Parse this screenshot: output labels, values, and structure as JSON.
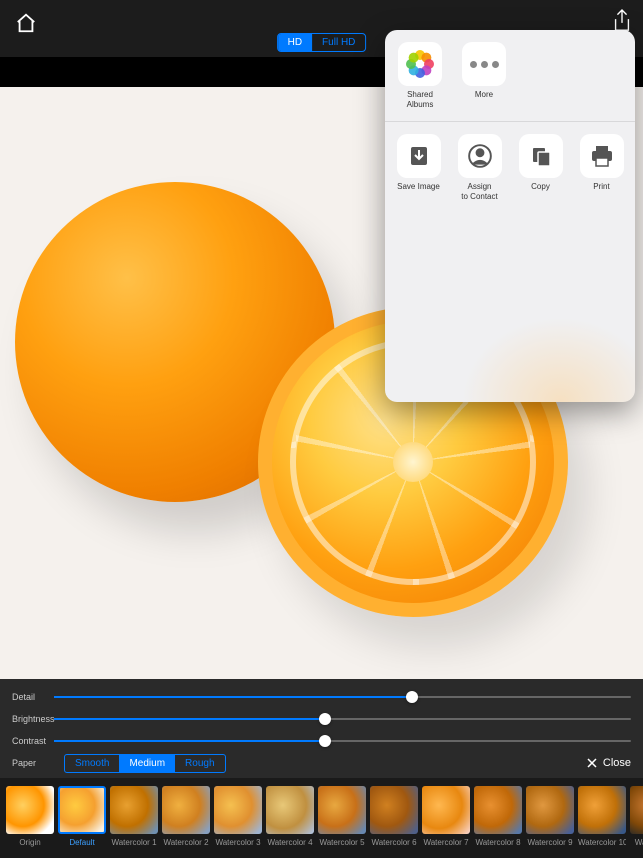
{
  "toolbar": {
    "quality": {
      "hd": "HD",
      "fullhd": "Full HD",
      "active": "hd"
    }
  },
  "sliders": {
    "detail": {
      "label": "Detail",
      "value": 62
    },
    "brightness": {
      "label": "Brightness",
      "value": 47
    },
    "contrast": {
      "label": "Contrast",
      "value": 47
    }
  },
  "paper": {
    "label": "Paper",
    "options": {
      "smooth": "Smooth",
      "medium": "Medium",
      "rough": "Rough"
    },
    "active": "medium"
  },
  "close_label": "Close",
  "filters": [
    {
      "id": "origin",
      "label": "Origin",
      "selected": false
    },
    {
      "id": "default",
      "label": "Default",
      "selected": true
    },
    {
      "id": "wc1",
      "label": "Watercolor 1",
      "selected": false
    },
    {
      "id": "wc2",
      "label": "Watercolor 2",
      "selected": false
    },
    {
      "id": "wc3",
      "label": "Watercolor 3",
      "selected": false
    },
    {
      "id": "wc4",
      "label": "Watercolor 4",
      "selected": false
    },
    {
      "id": "wc5",
      "label": "Watercolor 5",
      "selected": false
    },
    {
      "id": "wc6",
      "label": "Watercolor 6",
      "selected": false
    },
    {
      "id": "wc7",
      "label": "Watercolor 7",
      "selected": false
    },
    {
      "id": "wc8",
      "label": "Watercolor 8",
      "selected": false
    },
    {
      "id": "wc9",
      "label": "Watercolor 9",
      "selected": false
    },
    {
      "id": "wc10",
      "label": "Watercolor 10",
      "selected": false
    },
    {
      "id": "wc11",
      "label": "Watercolor",
      "selected": false
    },
    {
      "id": "wc12",
      "label": "",
      "selected": false
    }
  ],
  "share": {
    "apps": [
      {
        "id": "shared-albums",
        "label": "Shared Albums",
        "icon": "photos-icon"
      },
      {
        "id": "more",
        "label": "More",
        "icon": "more-icon"
      }
    ],
    "actions": [
      {
        "id": "save-image",
        "label": "Save Image",
        "icon": "download-icon"
      },
      {
        "id": "assign",
        "label": "Assign\nto Contact",
        "icon": "contact-icon"
      },
      {
        "id": "copy",
        "label": "Copy",
        "icon": "copy-icon"
      },
      {
        "id": "print",
        "label": "Print",
        "icon": "printer-icon"
      }
    ]
  }
}
